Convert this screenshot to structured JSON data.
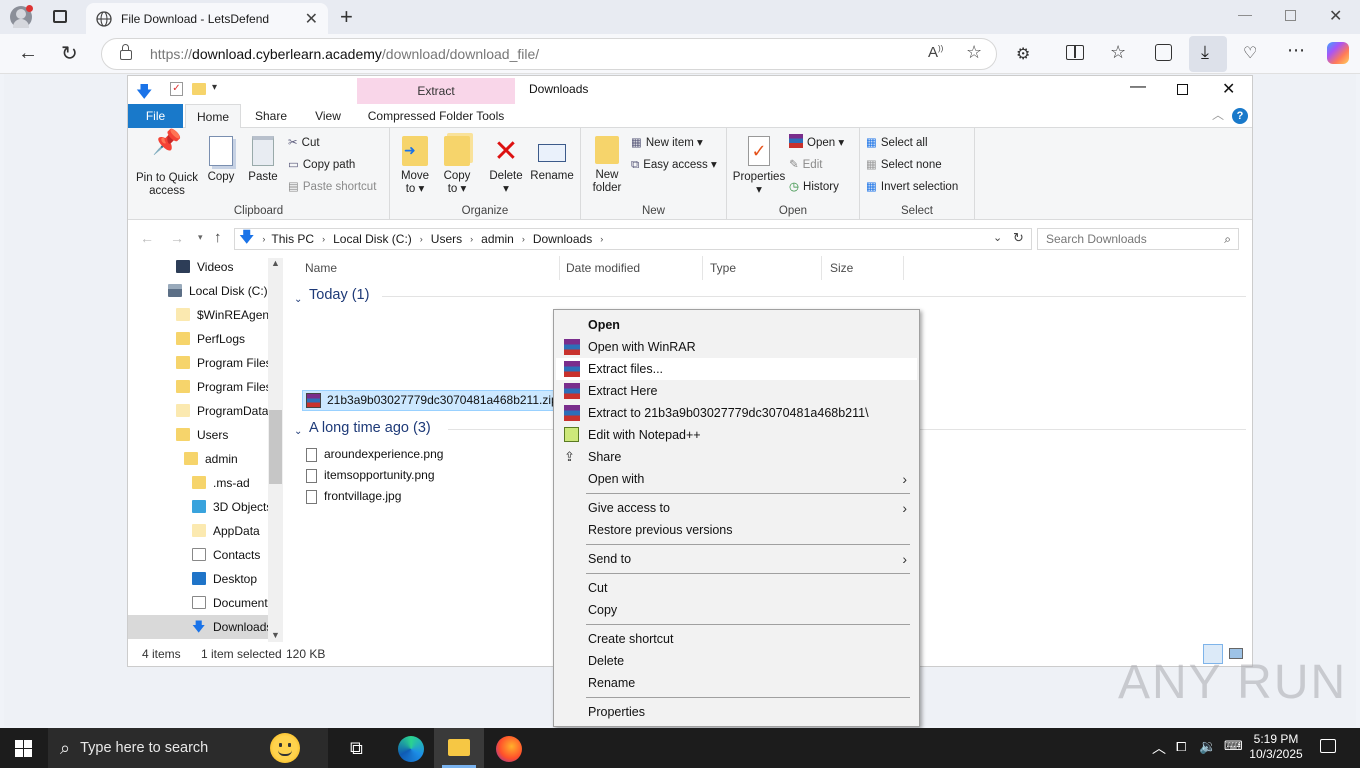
{
  "browser": {
    "tab_title": "File Download - LetsDefend",
    "url_scheme": "https://",
    "url_host": "download.cyberlearn.academy",
    "url_path": "/download/download_file/"
  },
  "explorer": {
    "window_title": "Downloads",
    "contextual_tab": "Extract",
    "ribbon_tabs": [
      "File",
      "Home",
      "Share",
      "View",
      "Compressed Folder Tools"
    ],
    "clipboard": {
      "pin": "Pin to Quick access",
      "copy": "Copy",
      "paste": "Paste",
      "cut": "Cut",
      "copy_path": "Copy path",
      "paste_shortcut": "Paste shortcut",
      "label": "Clipboard"
    },
    "organize": {
      "move_to": "Move to",
      "copy_to": "Copy to",
      "delete": "Delete",
      "rename": "Rename",
      "label": "Organize"
    },
    "new": {
      "new_folder": "New folder",
      "new_item": "New item",
      "easy_access": "Easy access",
      "label": "New"
    },
    "open": {
      "properties": "Properties",
      "open": "Open",
      "edit": "Edit",
      "history": "History",
      "label": "Open"
    },
    "select": {
      "select_all": "Select all",
      "select_none": "Select none",
      "invert": "Invert selection",
      "label": "Select"
    },
    "breadcrumb": [
      "This PC",
      "Local Disk (C:)",
      "Users",
      "admin",
      "Downloads"
    ],
    "search_placeholder": "Search Downloads",
    "nav_items": [
      {
        "label": "Videos",
        "indent": 1
      },
      {
        "label": "Local Disk (C:)",
        "indent": 0
      },
      {
        "label": "$WinREAgent",
        "indent": 1
      },
      {
        "label": "PerfLogs",
        "indent": 1
      },
      {
        "label": "Program Files",
        "indent": 1
      },
      {
        "label": "Program Files",
        "indent": 1
      },
      {
        "label": "ProgramData",
        "indent": 1
      },
      {
        "label": "Users",
        "indent": 1
      },
      {
        "label": "admin",
        "indent": 2
      },
      {
        "label": ".ms-ad",
        "indent": 3
      },
      {
        "label": "3D Objects",
        "indent": 3
      },
      {
        "label": "AppData",
        "indent": 3
      },
      {
        "label": "Contacts",
        "indent": 3
      },
      {
        "label": "Desktop",
        "indent": 3
      },
      {
        "label": "Documents",
        "indent": 3
      },
      {
        "label": "Downloads",
        "indent": 3
      }
    ],
    "columns": [
      "Name",
      "Date modified",
      "Type",
      "Size"
    ],
    "group_today": "Today (1)",
    "group_old": "A long time ago (3)",
    "selected_file": "21b3a9b03027779dc3070481a468b211.zip",
    "old_files": [
      "aroundexperience.png",
      "itemsopportunity.png",
      "frontvillage.jpg"
    ],
    "status_count": "4 items",
    "status_selected": "1 item selected",
    "status_size": "120 KB"
  },
  "context_menu": {
    "items": [
      "Open",
      "Open with WinRAR",
      "Extract files...",
      "Extract Here",
      "Extract to 21b3a9b03027779dc3070481a468b211\\",
      "Edit with Notepad++",
      "Share",
      "Open with",
      "Give access to",
      "Restore previous versions",
      "Send to",
      "Cut",
      "Copy",
      "Create shortcut",
      "Delete",
      "Rename",
      "Properties"
    ]
  },
  "taskbar": {
    "search_placeholder": "Type here to search",
    "time": "5:19 PM",
    "date": "10/3/2025"
  },
  "watermark": "ANY RUN",
  "colors": {
    "accent": "#0078d4",
    "selection": "#cce8ff",
    "extract_tab": "#f9d6e9",
    "taskbar": "#1c1c1c"
  }
}
